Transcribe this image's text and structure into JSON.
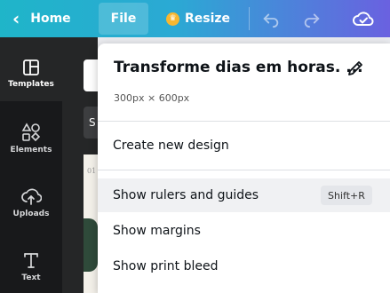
{
  "topbar": {
    "home_label": "Home",
    "file_label": "File",
    "resize_label": "Resize"
  },
  "sidebar": {
    "items": [
      {
        "label": "Templates"
      },
      {
        "label": "Elements"
      },
      {
        "label": "Uploads"
      },
      {
        "label": "Text"
      }
    ]
  },
  "panel": {
    "search_placeholder": "",
    "button_text": "S",
    "thumb_text": "01"
  },
  "menu": {
    "title": "Transforme dias em horas. ...",
    "dimensions": "300px × 600px",
    "items": [
      {
        "label": "Create new design"
      },
      {
        "label": "Show rulers and guides",
        "shortcut": "Shift+R"
      },
      {
        "label": "Show margins"
      },
      {
        "label": "Show print bleed"
      }
    ]
  },
  "colors": {
    "topbar_start": "#1fb5c9",
    "topbar_end": "#6a61e0",
    "sidebar_bg": "#18191b",
    "crown": "#f7b731"
  }
}
